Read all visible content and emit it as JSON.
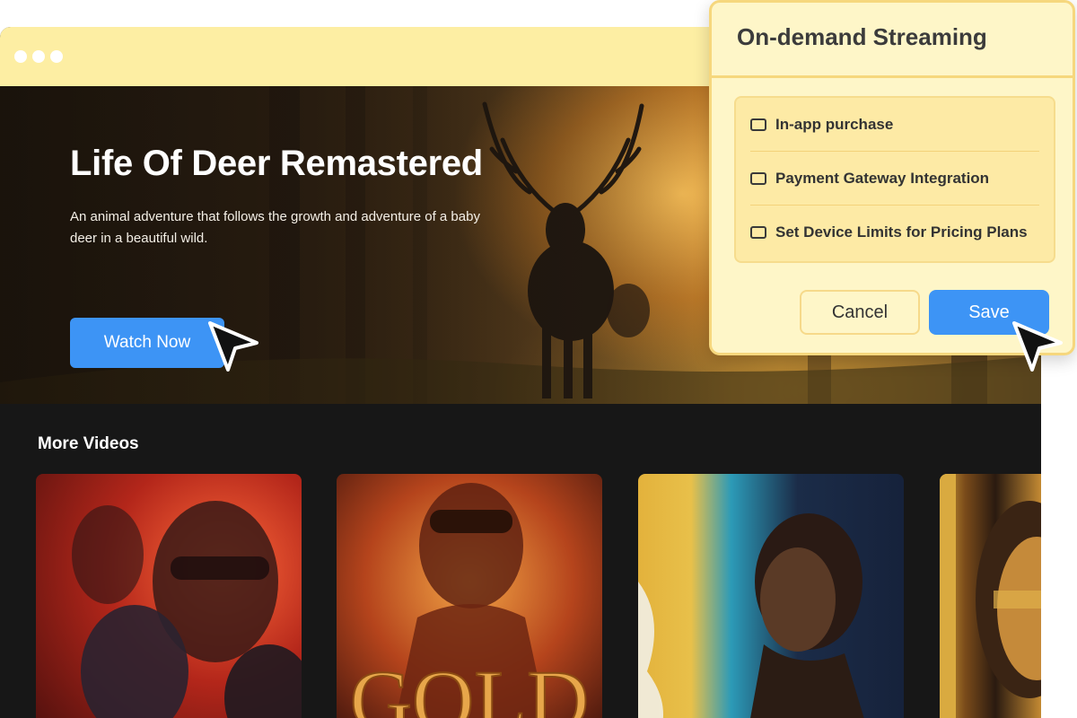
{
  "window": {
    "traffic_lights": [
      "dot",
      "dot",
      "dot"
    ]
  },
  "hero": {
    "title": "Life Of Deer Remastered",
    "description": "An animal adventure that follows the growth and adventure of a baby deer in a beautiful wild.",
    "watch_label": "Watch Now"
  },
  "more_videos": {
    "title": "More Videos",
    "cards": [
      {
        "id": "action"
      },
      {
        "id": "gold",
        "poster_text": "GOLD"
      },
      {
        "id": "portrait-blue"
      },
      {
        "id": "portrait-gold"
      }
    ]
  },
  "dialog": {
    "title": "On-demand Streaming",
    "options": [
      {
        "label": "In-app purchase",
        "checked": false
      },
      {
        "label": "Payment Gateway Integration",
        "checked": false
      },
      {
        "label": "Set Device Limits for Pricing Plans",
        "checked": false
      }
    ],
    "cancel_label": "Cancel",
    "save_label": "Save"
  },
  "colors": {
    "accent": "#3d94f5",
    "titlebar": "#fdeea3",
    "dialog_bg": "#fef6c8",
    "dialog_border": "#f6d77d",
    "page_bg": "#171717"
  },
  "icons": [
    "cursor-arrow-icon",
    "checkbox-icon"
  ]
}
